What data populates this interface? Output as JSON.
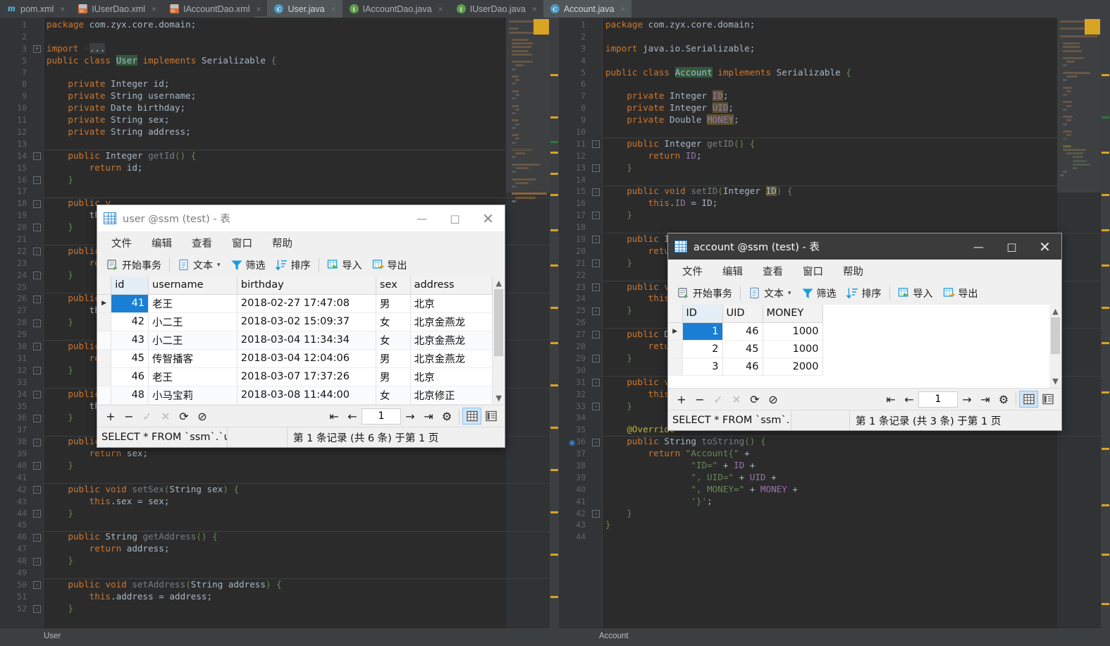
{
  "ide": {
    "tabs": [
      {
        "label": "pom.xml",
        "icon": "maven-icon",
        "icon_kind": "m",
        "active": false,
        "closable": true
      },
      {
        "label": "IUserDao.xml",
        "icon": "xml-file-icon",
        "icon_kind": "xml",
        "active": false,
        "closable": true
      },
      {
        "label": "IAccountDao.xml",
        "icon": "xml-file-icon",
        "icon_kind": "xml",
        "active": false,
        "closable": true
      },
      {
        "label": "User.java",
        "icon": "java-class-icon",
        "icon_kind": "c",
        "active": true,
        "closable": true
      },
      {
        "label": "IAccountDao.java",
        "icon": "java-interface-icon",
        "icon_kind": "i",
        "active": false,
        "closable": true
      },
      {
        "label": "IUserDao.java",
        "icon": "java-interface-icon",
        "icon_kind": "i",
        "active": false,
        "closable": true
      },
      {
        "label": "Account.java",
        "icon": "java-class-icon",
        "icon_kind": "c",
        "active": true,
        "closable": true
      }
    ],
    "breadcrumb_left": "User",
    "breadcrumb_right": "Account",
    "close_glyph": "×"
  },
  "editor_left": {
    "file": "User.java",
    "first_line": 1,
    "lines": [
      {
        "n": 1,
        "html": "<span class=\"kw\">package</span> com.zyx.core.domain<span class=\"punc\">;</span>"
      },
      {
        "n": 2,
        "html": ""
      },
      {
        "n": 3,
        "html": "<span class=\"kw\">import</span> <span class=\"dimdot\">·</span><span style=\"background:#3c3f41;color:#a9b7c6\">...</span>",
        "fold": "+"
      },
      {
        "n": 5,
        "html": "<span class=\"kw\">public class</span> <span class=\"hl\">User</span> <span class=\"kw\">implements</span> Serializable <span class=\"brc\">{</span>"
      },
      {
        "n": 7,
        "html": ""
      },
      {
        "n": 8,
        "html": "    <span class=\"kw\">private</span> Integer id<span class=\"punc\">;</span>"
      },
      {
        "n": 9,
        "html": "    <span class=\"kw\">private</span> String username<span class=\"punc\">;</span>"
      },
      {
        "n": 10,
        "html": "    <span class=\"kw\">private</span> Date birthday<span class=\"punc\">;</span>"
      },
      {
        "n": 11,
        "html": "    <span class=\"kw\">private</span> String sex<span class=\"punc\">;</span>"
      },
      {
        "n": 12,
        "html": "    <span class=\"kw\">private</span> String address<span class=\"punc\">;</span>"
      },
      {
        "n": 13,
        "html": ""
      },
      {
        "n": 14,
        "html": "    <span class=\"kw\">public</span> Integer <span class=\"mth\">getId</span><span class=\"brc\">()</span> <span class=\"brc\">{</span>",
        "fold": "-"
      },
      {
        "n": 15,
        "html": "        <span class=\"kw\">return</span> id<span class=\"punc\">;</span>"
      },
      {
        "n": 16,
        "html": "    <span class=\"brc\">}</span>",
        "fold": "-"
      },
      {
        "n": 17,
        "html": ""
      },
      {
        "n": 18,
        "html": "    <span class=\"kw\">public</span> <span class=\"kw\">v</span>",
        "fold": "-"
      },
      {
        "n": 19,
        "html": "        this"
      },
      {
        "n": 20,
        "html": "    <span class=\"brc\">}</span>",
        "fold": "-"
      },
      {
        "n": 21,
        "html": ""
      },
      {
        "n": 22,
        "html": "    <span class=\"kw\">public</span> S",
        "fold": "-"
      },
      {
        "n": 23,
        "html": "        <span class=\"kw\">retu</span>"
      },
      {
        "n": 24,
        "html": "    <span class=\"brc\">}</span>",
        "fold": "-"
      },
      {
        "n": 25,
        "html": ""
      },
      {
        "n": 26,
        "html": "    <span class=\"kw\">public</span> <span class=\"kw\">v</span>",
        "fold": "-"
      },
      {
        "n": 27,
        "html": "        this"
      },
      {
        "n": 28,
        "html": "    <span class=\"brc\">}</span>",
        "fold": "-"
      },
      {
        "n": 29,
        "html": ""
      },
      {
        "n": 30,
        "html": "    <span class=\"kw\">public</span> D",
        "fold": "-"
      },
      {
        "n": 31,
        "html": "        <span class=\"kw\">retu</span>"
      },
      {
        "n": 32,
        "html": "    <span class=\"brc\">}</span>",
        "fold": "-"
      },
      {
        "n": 33,
        "html": ""
      },
      {
        "n": 34,
        "html": "    <span class=\"kw\">public</span> <span class=\"kw\">v</span>",
        "fold": "-"
      },
      {
        "n": 35,
        "html": "        this"
      },
      {
        "n": 36,
        "html": "    <span class=\"brc\">}</span>",
        "fold": "-"
      },
      {
        "n": 37,
        "html": ""
      },
      {
        "n": 38,
        "html": "    <span class=\"kw\">public</span> String <span class=\"mth\">getSex</span><span class=\"brc\">()</span> <span class=\"brc\">{</span>",
        "fold": "-"
      },
      {
        "n": 39,
        "html": "        <span class=\"kw\">return</span> sex<span class=\"punc\">;</span>"
      },
      {
        "n": 40,
        "html": "    <span class=\"brc\">}</span>",
        "fold": "-"
      },
      {
        "n": 41,
        "html": ""
      },
      {
        "n": 42,
        "html": "    <span class=\"kw\">public</span> <span class=\"kw\">void</span> <span class=\"mth\">setSex</span><span class=\"brc\">(</span>String sex<span class=\"brc\">)</span> <span class=\"brc\">{</span>",
        "fold": "-"
      },
      {
        "n": 43,
        "html": "        <span class=\"kw\">this</span>.sex = sex<span class=\"punc\">;</span>"
      },
      {
        "n": 44,
        "html": "    <span class=\"brc\">}</span>",
        "fold": "-"
      },
      {
        "n": 45,
        "html": ""
      },
      {
        "n": 46,
        "html": "    <span class=\"kw\">public</span> String <span class=\"mth\">getAddress</span><span class=\"brc\">()</span> <span class=\"brc\">{</span>",
        "fold": "-"
      },
      {
        "n": 47,
        "html": "        <span class=\"kw\">return</span> address<span class=\"punc\">;</span>"
      },
      {
        "n": 48,
        "html": "    <span class=\"brc\">}</span>",
        "fold": "-"
      },
      {
        "n": 49,
        "html": ""
      },
      {
        "n": 50,
        "html": "    <span class=\"kw\">public</span> <span class=\"kw\">void</span> <span class=\"mth\">setAddress</span><span class=\"brc\">(</span>String address<span class=\"brc\">)</span> <span class=\"brc\">{</span>",
        "fold": "-"
      },
      {
        "n": 51,
        "html": "        <span class=\"kw\">this</span>.address = address<span class=\"punc\">;</span>"
      },
      {
        "n": 52,
        "html": "    <span class=\"brc\">}</span>",
        "fold": "-"
      }
    ]
  },
  "editor_right": {
    "file": "Account.java",
    "lines": [
      {
        "n": 1,
        "html": "<span class=\"kw\">package</span> com.zyx.core.domain<span class=\"punc\">;</span>"
      },
      {
        "n": 2,
        "html": ""
      },
      {
        "n": 3,
        "html": "<span class=\"kw\">import</span> java.io.Serializable<span class=\"punc\">;</span>"
      },
      {
        "n": 4,
        "html": ""
      },
      {
        "n": 5,
        "html": "<span class=\"kw\">public class</span> <span class=\"hl\">Account</span> <span class=\"kw\">implements</span> Serializable <span class=\"brc\">{</span>"
      },
      {
        "n": 6,
        "html": ""
      },
      {
        "n": 7,
        "html": "    <span class=\"kw\">private</span> Integer <span class=\"hl2 fld\">ID</span><span class=\"punc\">;</span>"
      },
      {
        "n": 8,
        "html": "    <span class=\"kw\">private</span> Integer <span class=\"hl2 fld\">UID</span><span class=\"punc\">;</span>"
      },
      {
        "n": 9,
        "html": "    <span class=\"kw\">private</span> Double <span class=\"hl2 fld\">MONEY</span><span class=\"punc\">;</span>"
      },
      {
        "n": 10,
        "html": ""
      },
      {
        "n": 11,
        "html": "    <span class=\"kw\">public</span> Integer <span class=\"mth\">getID</span><span class=\"brc\">()</span> <span class=\"brc\">{</span>",
        "fold": "-"
      },
      {
        "n": 12,
        "html": "        <span class=\"kw\">return</span> <span class=\"fld\">ID</span><span class=\"punc\">;</span>"
      },
      {
        "n": 13,
        "html": "    <span class=\"brc\">}</span>",
        "fold": "-"
      },
      {
        "n": 14,
        "html": ""
      },
      {
        "n": 15,
        "html": "    <span class=\"kw\">public</span> <span class=\"kw\">void</span> <span class=\"mth\">setID</span><span class=\"brc\">(</span>Integer <span class=\"hl2\">ID</span><span class=\"brc\">)</span> <span class=\"brc\">{</span>",
        "fold": "-"
      },
      {
        "n": 16,
        "html": "        <span class=\"kw\">this</span>.<span class=\"fld\">ID</span> = ID<span class=\"punc\">;</span>"
      },
      {
        "n": 17,
        "html": "    <span class=\"brc\">}</span>",
        "fold": "-"
      },
      {
        "n": 18,
        "html": ""
      },
      {
        "n": 19,
        "html": "    <span class=\"kw\">public</span> Int",
        "fold": "-"
      },
      {
        "n": 20,
        "html": "        <span class=\"kw\">return</span>"
      },
      {
        "n": 21,
        "html": "    <span class=\"brc\">}</span>",
        "fold": "-"
      },
      {
        "n": 22,
        "html": ""
      },
      {
        "n": 23,
        "html": "    <span class=\"kw\">public</span> <span class=\"kw\">voi</span>",
        "fold": "-"
      },
      {
        "n": 24,
        "html": "        <span class=\"kw\">this</span>.U"
      },
      {
        "n": 25,
        "html": "    <span class=\"brc\">}</span>",
        "fold": "-"
      },
      {
        "n": 26,
        "html": ""
      },
      {
        "n": 27,
        "html": "    <span class=\"kw\">public</span> Doub",
        "fold": "-"
      },
      {
        "n": 28,
        "html": "        <span class=\"kw\">return</span>"
      },
      {
        "n": 29,
        "html": "    <span class=\"brc\">}</span>",
        "fold": "-"
      },
      {
        "n": 30,
        "html": ""
      },
      {
        "n": 31,
        "html": "    <span class=\"kw\">public</span> <span class=\"kw\">voi</span>",
        "fold": "-"
      },
      {
        "n": 32,
        "html": "        <span class=\"kw\">this</span>.M"
      },
      {
        "n": 33,
        "html": "    <span class=\"brc\">}</span>",
        "fold": "-"
      },
      {
        "n": 34,
        "html": ""
      },
      {
        "n": 35,
        "html": "    <span class=\"ann\">@Override</span>"
      },
      {
        "n": 36,
        "html": "    <span class=\"kw\">public</span> String <span class=\"mth\">toString</span><span class=\"brc\">()</span> <span class=\"brc\">{</span>",
        "fold": "-",
        "gutter_icon": "override-method-icon"
      },
      {
        "n": 37,
        "html": "        <span class=\"kw\">return</span> <span class=\"str\">\"Account{\"</span> +"
      },
      {
        "n": 38,
        "html": "                <span class=\"str\">\"ID=\"</span> + <span class=\"fld\">ID</span> +"
      },
      {
        "n": 39,
        "html": "                <span class=\"str\">\", UID=\"</span> + <span class=\"fld\">UID</span> +"
      },
      {
        "n": 40,
        "html": "                <span class=\"str\">\", MONEY=\"</span> + <span class=\"fld\">MONEY</span> +"
      },
      {
        "n": 41,
        "html": "                <span class=\"str\">'}'</span><span class=\"punc\">;</span>"
      },
      {
        "n": 42,
        "html": "    <span class=\"brc\">}</span>",
        "fold": "-"
      },
      {
        "n": 43,
        "html": "<span class=\"brc\">}</span>"
      },
      {
        "n": 44,
        "html": ""
      }
    ]
  },
  "user_window": {
    "title": "user @ssm (test) - 表",
    "icon": "table-grid-icon",
    "window_controls": {
      "minimize": "—",
      "maximize": "□",
      "close": "✕"
    },
    "menu": [
      "文件",
      "编辑",
      "查看",
      "窗口",
      "帮助"
    ],
    "toolbar": [
      {
        "label": "开始事务",
        "icon": "begin-transaction-icon"
      },
      {
        "label": "文本",
        "icon": "text-icon",
        "has_caret": true
      },
      {
        "label": "筛选",
        "icon": "filter-icon"
      },
      {
        "label": "排序",
        "icon": "sort-icon"
      },
      {
        "label": "导入",
        "icon": "import-icon"
      },
      {
        "label": "导出",
        "icon": "export-icon"
      }
    ],
    "columns": [
      "id",
      "username",
      "birthday",
      "sex",
      "address"
    ],
    "rows": [
      {
        "id": "41",
        "username": "老王",
        "birthday": "2018-02-27 17:47:08",
        "sex": "男",
        "address": "北京"
      },
      {
        "id": "42",
        "username": "小二王",
        "birthday": "2018-03-02 15:09:37",
        "sex": "女",
        "address": "北京金燕龙"
      },
      {
        "id": "43",
        "username": "小二王",
        "birthday": "2018-03-04 11:34:34",
        "sex": "女",
        "address": "北京金燕龙"
      },
      {
        "id": "45",
        "username": "传智播客",
        "birthday": "2018-03-04 12:04:06",
        "sex": "男",
        "address": "北京金燕龙"
      },
      {
        "id": "46",
        "username": "老王",
        "birthday": "2018-03-07 17:37:26",
        "sex": "男",
        "address": "北京"
      },
      {
        "id": "48",
        "username": "小马宝莉",
        "birthday": "2018-03-08 11:44:00",
        "sex": "女",
        "address": "北京修正"
      }
    ],
    "selected_row_index": 0,
    "bottom_buttons": [
      {
        "name": "add-record-button",
        "glyph": "+",
        "disabled": false
      },
      {
        "name": "delete-record-button",
        "glyph": "−",
        "disabled": false
      },
      {
        "name": "apply-change-button",
        "glyph": "✓",
        "disabled": true
      },
      {
        "name": "cancel-change-button",
        "glyph": "✕",
        "disabled": true
      },
      {
        "name": "refresh-button",
        "glyph": "⟳",
        "disabled": false
      },
      {
        "name": "stop-button",
        "glyph": "⊘",
        "disabled": false
      }
    ],
    "nav": {
      "first": "⧏|",
      "prev": "←",
      "page": "1",
      "next": "→",
      "last": "|⧐",
      "settings": "⚙"
    },
    "view_toggle": {
      "grid": "grid-view-icon",
      "form": "form-view-icon",
      "active": "grid"
    },
    "status_sql": "SELECT * FROM `ssm`.`use",
    "status_record": "第 1 条记录 (共 6 条) 于第 1 页"
  },
  "account_window": {
    "title": "account @ssm (test) - 表",
    "icon": "table-grid-icon",
    "window_controls": {
      "minimize": "—",
      "maximize": "□",
      "close": "✕"
    },
    "menu": [
      "文件",
      "编辑",
      "查看",
      "窗口",
      "帮助"
    ],
    "toolbar": [
      {
        "label": "开始事务",
        "icon": "begin-transaction-icon"
      },
      {
        "label": "文本",
        "icon": "text-icon",
        "has_caret": true
      },
      {
        "label": "筛选",
        "icon": "filter-icon"
      },
      {
        "label": "排序",
        "icon": "sort-icon"
      },
      {
        "label": "导入",
        "icon": "import-icon"
      },
      {
        "label": "导出",
        "icon": "export-icon"
      }
    ],
    "columns": [
      "ID",
      "UID",
      "MONEY"
    ],
    "rows": [
      {
        "ID": "1",
        "UID": "46",
        "MONEY": "1000"
      },
      {
        "ID": "2",
        "UID": "45",
        "MONEY": "1000"
      },
      {
        "ID": "3",
        "UID": "46",
        "MONEY": "2000"
      }
    ],
    "selected_row_index": 0,
    "bottom_buttons": [
      {
        "name": "add-record-button",
        "glyph": "+",
        "disabled": false
      },
      {
        "name": "delete-record-button",
        "glyph": "−",
        "disabled": false
      },
      {
        "name": "apply-change-button",
        "glyph": "✓",
        "disabled": true
      },
      {
        "name": "cancel-change-button",
        "glyph": "✕",
        "disabled": true
      },
      {
        "name": "refresh-button",
        "glyph": "⟳",
        "disabled": false
      },
      {
        "name": "stop-button",
        "glyph": "⊘",
        "disabled": false
      }
    ],
    "nav": {
      "first": "⧏|",
      "prev": "←",
      "page": "1",
      "next": "→",
      "last": "|⧐",
      "settings": "⚙"
    },
    "view_toggle": {
      "grid": "grid-view-icon",
      "form": "form-view-icon",
      "active": "grid"
    },
    "status_sql": "SELECT * FROM `ssm`.`",
    "status_record": "第 1 条记录 (共 3 条) 于第 1 页"
  },
  "colors": {
    "ide_chrome": "#3c3f41",
    "editor_bg": "#2b2b2b",
    "gutter_bg": "#313335",
    "keyword": "#cc7832",
    "field": "#9876aa",
    "string": "#6a8759",
    "annotation": "#bbb529",
    "selection_blue": "#1a7fd4",
    "navicat_toolbar_blue": "#2f9fd9",
    "marker_yellow": "#d9a323"
  }
}
